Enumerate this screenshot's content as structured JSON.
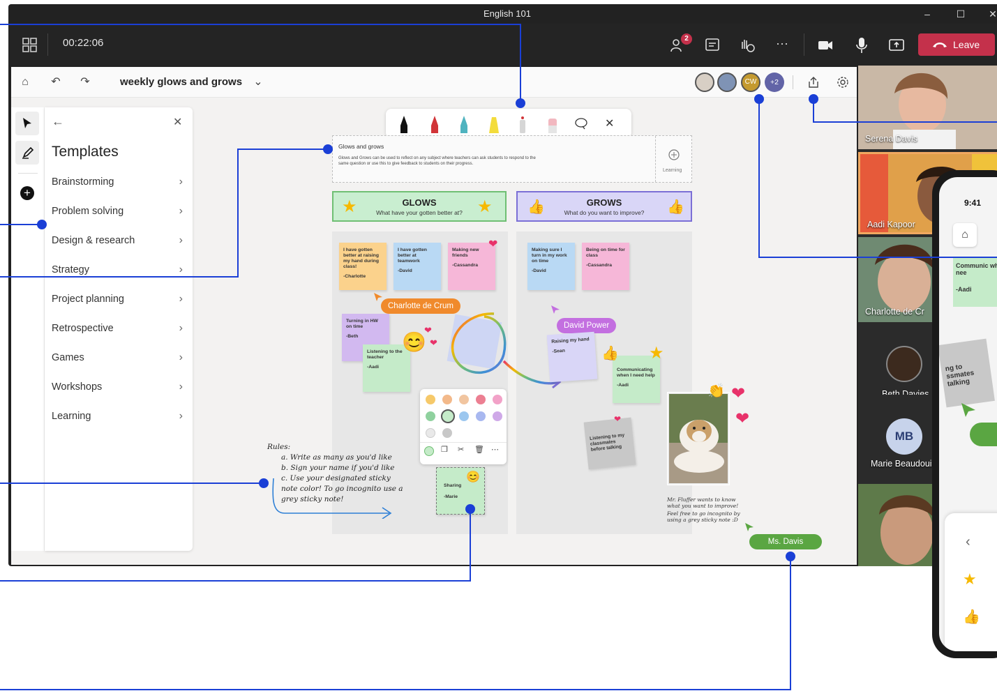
{
  "window": {
    "title": "English 101"
  },
  "callbar": {
    "timer": "00:22:06",
    "people_badge": "2",
    "leave_label": "Leave"
  },
  "whiteboard": {
    "title": "weekly glows and grows",
    "avatars": {
      "cw": "CW",
      "extra": "+2"
    }
  },
  "templates": {
    "heading": "Templates",
    "items": [
      {
        "label": "Brainstorming"
      },
      {
        "label": "Problem solving"
      },
      {
        "label": "Design & research"
      },
      {
        "label": "Strategy"
      },
      {
        "label": "Project planning"
      },
      {
        "label": "Retrospective"
      },
      {
        "label": "Games"
      },
      {
        "label": "Workshops"
      },
      {
        "label": "Learning"
      }
    ]
  },
  "board": {
    "header_title": "Glows and grows",
    "header_desc": "Glows and Grows can be used to reflect on any subject where teachers can ask students to respond to the same question or use this to give feedback to students on their progress.",
    "header_badge": "Learning",
    "glows": {
      "title": "GLOWS",
      "subtitle": "What have your gotten better at?"
    },
    "grows": {
      "title": "GROWS",
      "subtitle": "What do you want to improve?"
    },
    "stickies": {
      "s1": {
        "text": "I have gotten better at raising my hand during class!",
        "sig": "-Charlotte"
      },
      "s2": {
        "text": "I have gotten better at teamwork",
        "sig": "-David"
      },
      "s3": {
        "text": "Making new friends",
        "sig": "-Cassandra"
      },
      "s4": {
        "text": "Turning in HW on time",
        "sig": "-Beth"
      },
      "s5": {
        "text": "Listening to the teacher",
        "sig": "-Aadi"
      },
      "s6": {
        "text": "Making sure I turn in my work on time",
        "sig": "-David"
      },
      "s7": {
        "text": "Being on time for class",
        "sig": "-Cassandra"
      },
      "s8": {
        "text": "Raising my hand",
        "sig": "-Sean"
      },
      "s9": {
        "text": "Communicating when I need help",
        "sig": "-Aadi"
      },
      "s10": {
        "text": "Listening to my classmates before talking",
        "sig": ""
      },
      "s11": {
        "text": "Sharing",
        "sig": "-Marie"
      }
    },
    "cursor_tags": {
      "charlotte": "Charlotte de Crum",
      "david": "David Power",
      "msdavis": "Ms. Davis"
    },
    "rules": {
      "heading": "Rules:",
      "a": "a. Write as many as you'd like",
      "b": "b. Sign your name if you'd like",
      "c": "c. Use your designated sticky note color! To go incognito use a grey sticky note!"
    },
    "photo_note_1": "Mr. Fluffer wants to know what you want to improve!",
    "photo_note_2": "Feel free to go incognito by using a grey sticky note :D"
  },
  "gallery": {
    "tiles": [
      {
        "name": "Serena Davis"
      },
      {
        "name": "Aadi Kapoor"
      },
      {
        "name": "Charlotte de Cr"
      },
      {
        "name": "Beth Davies"
      },
      {
        "name": "Marie Beaudouin",
        "initials": "MB"
      }
    ]
  },
  "phone": {
    "time": "9:41",
    "note1_text": "Communic when I nee",
    "note1_sig": "-Aadi",
    "note2_text": "ng to ssmates talking"
  },
  "colors": {
    "glows_border": "#6fbf73",
    "glows_bg": "#c9eed0",
    "grows_border": "#7b6fd6",
    "grows_bg": "#d9d6f7",
    "leave": "#c4314b",
    "callout": "#1a3fd6"
  }
}
